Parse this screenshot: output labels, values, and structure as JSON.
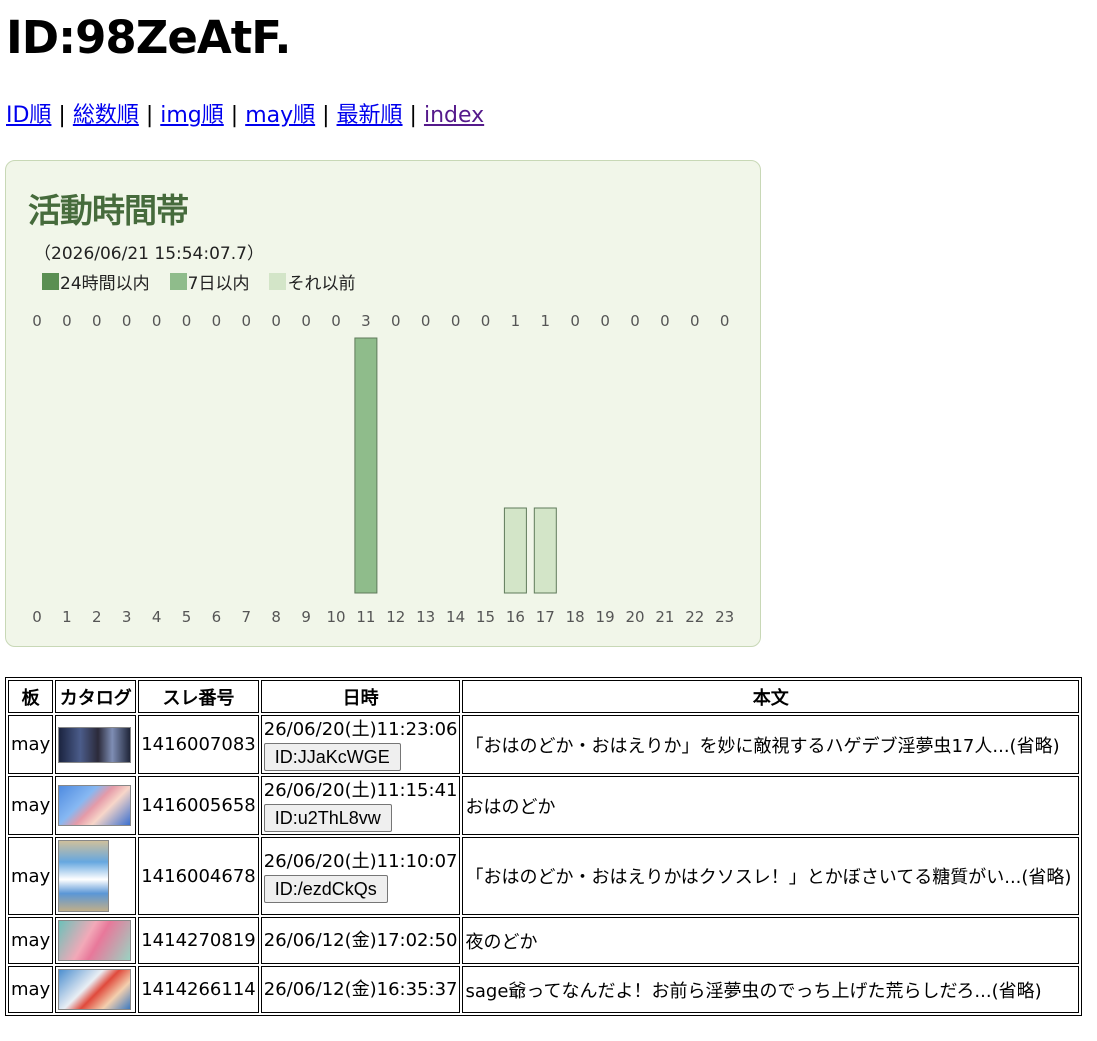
{
  "page": {
    "title": "ID:98ZeAtF."
  },
  "nav": {
    "links": [
      {
        "label": "ID順",
        "visited": false
      },
      {
        "label": "総数順",
        "visited": false
      },
      {
        "label": "img順",
        "visited": false
      },
      {
        "label": "may順",
        "visited": false
      },
      {
        "label": "最新順",
        "visited": false
      },
      {
        "label": "index",
        "visited": true
      }
    ],
    "separator": " | "
  },
  "activity": {
    "title": "活動時間帯",
    "timestamp": "（2026/06/21 15:54:07.7）",
    "legend": [
      {
        "label": "24時間以内",
        "color": "#5a8f52"
      },
      {
        "label": "7日以内",
        "color": "#8fbc8b"
      },
      {
        "label": "それ以前",
        "color": "#d3e5c8"
      }
    ]
  },
  "chart_data": {
    "type": "bar",
    "categories": [
      "0",
      "1",
      "2",
      "3",
      "4",
      "5",
      "6",
      "7",
      "8",
      "9",
      "10",
      "11",
      "12",
      "13",
      "14",
      "15",
      "16",
      "17",
      "18",
      "19",
      "20",
      "21",
      "22",
      "23"
    ],
    "values": [
      0,
      0,
      0,
      0,
      0,
      0,
      0,
      0,
      0,
      0,
      0,
      3,
      0,
      0,
      0,
      0,
      1,
      1,
      0,
      0,
      0,
      0,
      0,
      0
    ],
    "bar_tiers": [
      "",
      "",
      "",
      "",
      "",
      "",
      "",
      "",
      "",
      "",
      "",
      "7日以内",
      "",
      "",
      "",
      "",
      "それ以前",
      "それ以前",
      "",
      "",
      "",
      "",
      "",
      ""
    ],
    "ylim": [
      0,
      3
    ],
    "grid": false,
    "colors": {
      "24時間以内": "#5a8f52",
      "7日以内": "#8fbc8b",
      "それ以前": "#d3e5c8"
    }
  },
  "table": {
    "headers": [
      "板",
      "カタログ",
      "スレ番号",
      "日時",
      "本文"
    ],
    "rows": [
      {
        "board": "may",
        "thumb": "t1",
        "thread": "1416007083",
        "datetime": "26/06/20(土)11:23:06",
        "id_button": "ID:JJaKcWGE",
        "body": "「おはのどか・おはえりか」を妙に敵視するハゲデブ淫夢虫17人...(省略)"
      },
      {
        "board": "may",
        "thumb": "t2",
        "thread": "1416005658",
        "datetime": "26/06/20(土)11:15:41",
        "id_button": "ID:u2ThL8vw",
        "body": "おはのどか"
      },
      {
        "board": "may",
        "thumb": "t3",
        "thread": "1416004678",
        "datetime": "26/06/20(土)11:10:07",
        "id_button": "ID:/ezdCkQs",
        "body": "「おはのどか・おはえりかはクソスレ！」とかぼさいてる糖質がい...(省略)"
      },
      {
        "board": "may",
        "thumb": "t4",
        "thread": "1414270819",
        "datetime": "26/06/12(金)17:02:50",
        "id_button": "",
        "body": "夜のどか"
      },
      {
        "board": "may",
        "thumb": "t5",
        "thread": "1414266114",
        "datetime": "26/06/12(金)16:35:37",
        "id_button": "",
        "body": "sage爺ってなんだよ！お前ら淫夢虫のでっち上げた荒らしだろ...(省略)"
      }
    ]
  }
}
